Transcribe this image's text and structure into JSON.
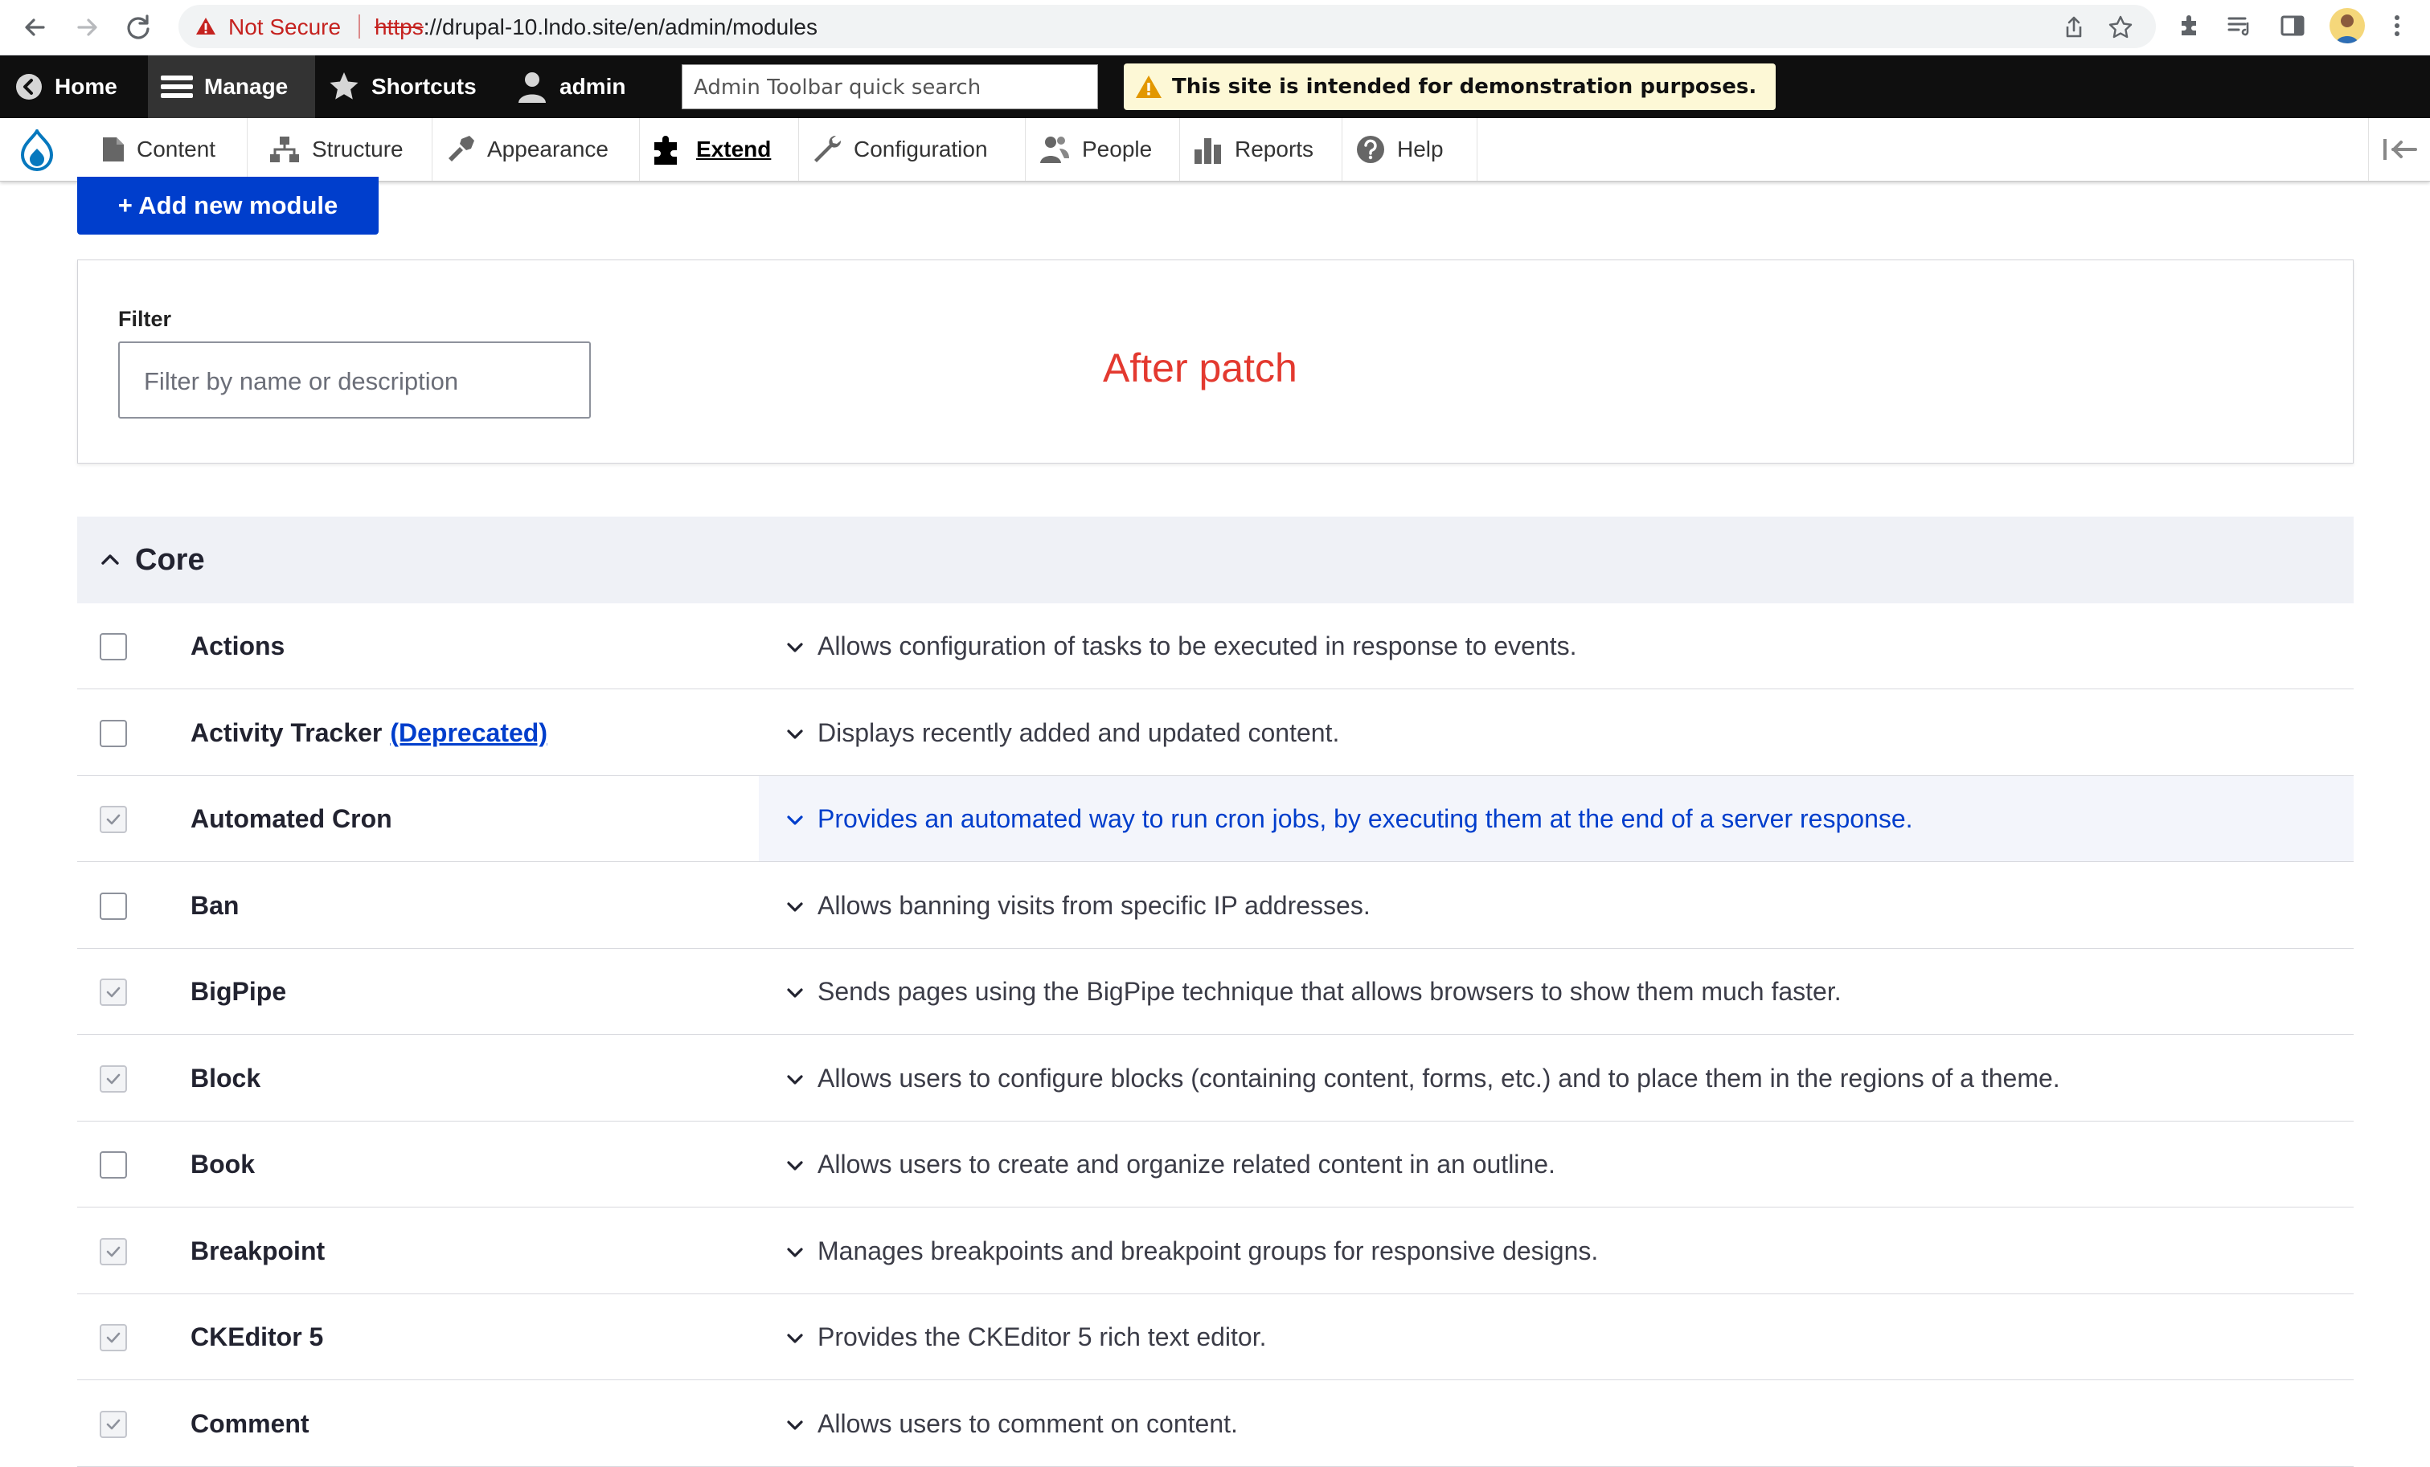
{
  "browser": {
    "security_label": "Not Secure",
    "url_scheme": "https",
    "url_rest": "://drupal-10.lndo.site/en/admin/modules"
  },
  "toolbar": {
    "home": "Home",
    "manage": "Manage",
    "shortcuts": "Shortcuts",
    "user": "admin",
    "search_placeholder": "Admin Toolbar quick search",
    "demo_notice": "This site is intended for demonstration purposes."
  },
  "tray": {
    "items": [
      "Content",
      "Structure",
      "Appearance",
      "Extend",
      "Configuration",
      "People",
      "Reports",
      "Help"
    ],
    "active": "Extend"
  },
  "page": {
    "add_button": "+ Add new module",
    "filter_label": "Filter",
    "filter_placeholder": "Filter by name or description",
    "annotation": "After patch",
    "colors": {
      "primary": "#003ecc",
      "annotation": "#e3392f"
    }
  },
  "core": {
    "title": "Core",
    "modules": [
      {
        "name": "Actions",
        "enabled": false,
        "desc": "Allows configuration of tasks to be executed in response to events."
      },
      {
        "name": "Activity Tracker",
        "tag": "(Deprecated)",
        "enabled": false,
        "desc": "Displays recently added and updated content."
      },
      {
        "name": "Automated Cron",
        "enabled": true,
        "highlighted": true,
        "desc": "Provides an automated way to run cron jobs, by executing them at the end of a server response."
      },
      {
        "name": "Ban",
        "enabled": false,
        "desc": "Allows banning visits from specific IP addresses."
      },
      {
        "name": "BigPipe",
        "enabled": true,
        "desc": "Sends pages using the BigPipe technique that allows browsers to show them much faster."
      },
      {
        "name": "Block",
        "enabled": true,
        "desc": "Allows users to configure blocks (containing content, forms, etc.) and to place them in the regions of a theme."
      },
      {
        "name": "Book",
        "enabled": false,
        "desc": "Allows users to create and organize related content in an outline."
      },
      {
        "name": "Breakpoint",
        "enabled": true,
        "desc": "Manages breakpoints and breakpoint groups for responsive designs."
      },
      {
        "name": "CKEditor 5",
        "enabled": true,
        "desc": "Provides the CKEditor 5 rich text editor."
      },
      {
        "name": "Comment",
        "enabled": true,
        "desc": "Allows users to comment on content."
      }
    ]
  }
}
